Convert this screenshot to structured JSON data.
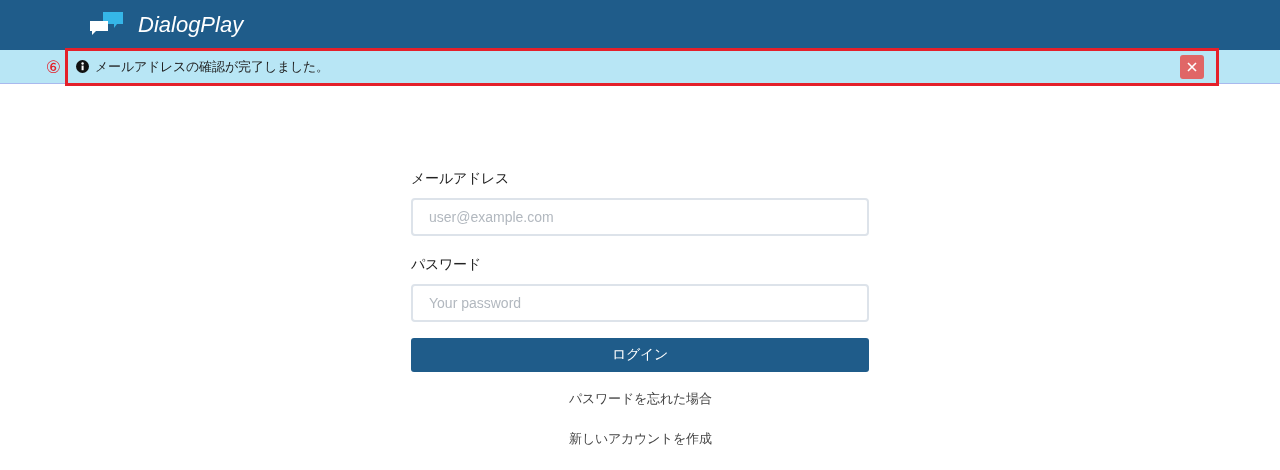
{
  "header": {
    "title": "DialogPlay"
  },
  "alert": {
    "callout": "⑥",
    "message": "メールアドレスの確認が完了しました。",
    "highlighted": true,
    "dismissible": true
  },
  "form": {
    "fields": [
      {
        "label": "メールアドレス",
        "placeholder": "user@example.com"
      },
      {
        "label": "パスワード",
        "placeholder": "Your password"
      }
    ],
    "submit": "ログイン",
    "links": [
      "パスワードを忘れた場合",
      "新しいアカウントを作成"
    ]
  }
}
